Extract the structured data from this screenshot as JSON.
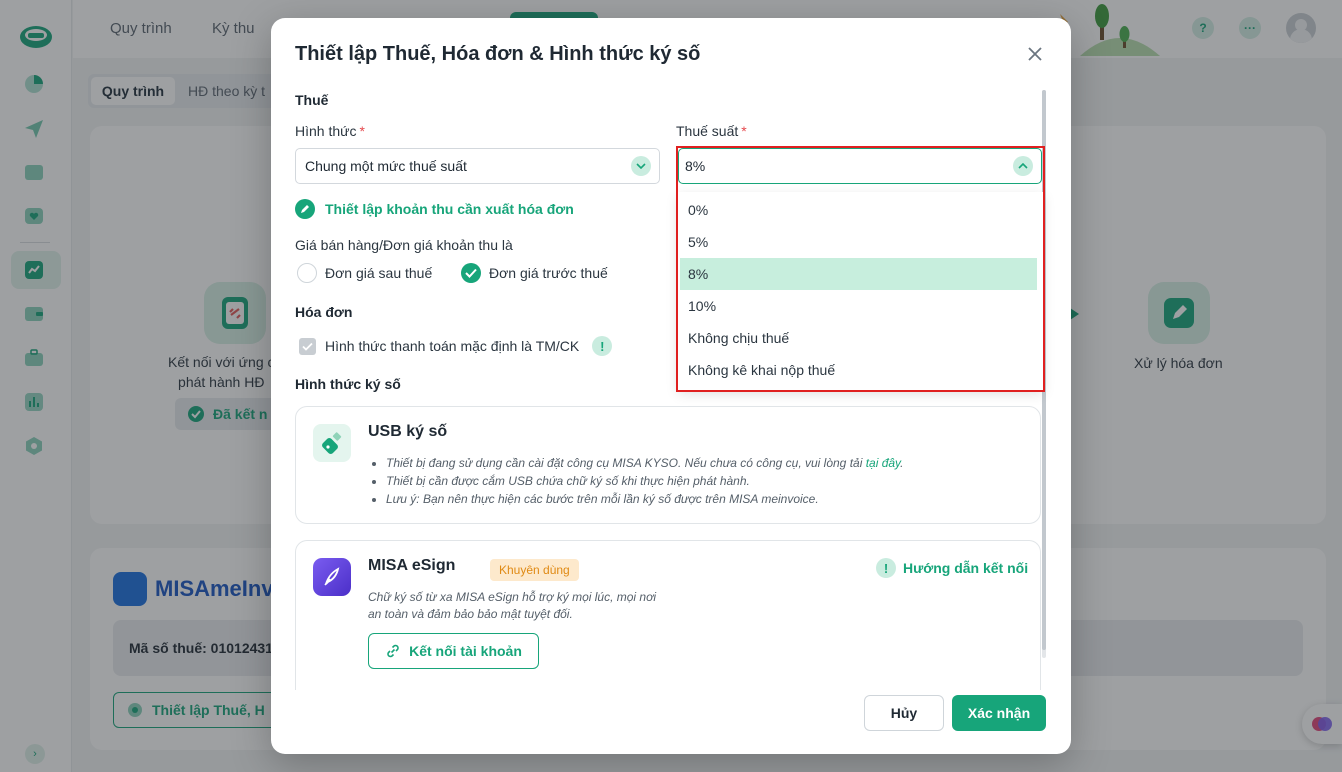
{
  "app": {
    "nav": [
      "Quy trình",
      "Kỳ thu"
    ],
    "subtabs": [
      "Quy trình",
      "HĐ theo kỳ t"
    ],
    "steps": {
      "connect_label_line1": "Kết nối với ứng c",
      "connect_label_line2": "phát hành HĐ",
      "connected_badge": "Đã kết n",
      "process_label": "Xử lý hóa đơn"
    },
    "brand": "MISAmeInv",
    "taxcode_label": "Mã số thuế: 01012431",
    "setup_button": "Thiết lập Thuế, H"
  },
  "modal": {
    "title": "Thiết lập Thuế, Hóa đơn & Hình thức ký số",
    "tax_section": "Thuế",
    "form_label": "Hình thức",
    "form_value": "Chung một mức thuế suất",
    "rate_label": "Thuế suất",
    "rate_value": "8%",
    "required_mark": "*",
    "setup_link": "Thiết lập khoản thu cần xuất hóa đơn",
    "price_label": "Giá bán hàng/Đơn giá khoản thu là",
    "radio_after_tax": "Đơn giá sau thuế",
    "radio_before_tax": "Đơn giá trước thuế",
    "selected_price_mode": "Đơn giá trước thuế",
    "invoice_section": "Hóa đơn",
    "payment_checkbox": "Hình thức thanh toán mặc định là TM/CK",
    "info_mark": "!",
    "sign_section": "Hình thức ký số",
    "usb": {
      "title": "USB ký số",
      "bullet1_text": "Thiết bị đang sử dụng cần cài đặt công cụ MISA KYSO. Nếu chưa có công cụ, vui lòng tải ",
      "bullet1_link": "tại đây",
      "bullet1_end": ".",
      "bullet2": "Thiết bị cần được cắm USB chứa chữ ký số khi thực hiện phát hành.",
      "bullet3": "Lưu ý: Bạn nên thực hiện các bước trên mỗi lần ký số được trên MISA meinvoice."
    },
    "esign": {
      "title": "MISA eSign",
      "badge": "Khuyên dùng",
      "guide_link": "Hướng dẫn kết nối",
      "desc_line1": "Chữ ký số từ xa MISA eSign hỗ trợ ký mọi lúc, mọi nơi",
      "desc_line2": "an toàn và đảm bảo bảo mật tuyệt đối.",
      "connect_button": "Kết nối tài khoản"
    },
    "cancel_button": "Hủy",
    "confirm_button": "Xác nhận",
    "rate_options": [
      "0%",
      "5%",
      "8%",
      "10%",
      "Không chịu thuế",
      "Không kê khai nộp thuế"
    ],
    "selected_rate": "8%"
  },
  "colors": {
    "accent": "#17a57a",
    "highlight_frame": "#e02020",
    "selected_option_bg": "#c7eedd"
  }
}
